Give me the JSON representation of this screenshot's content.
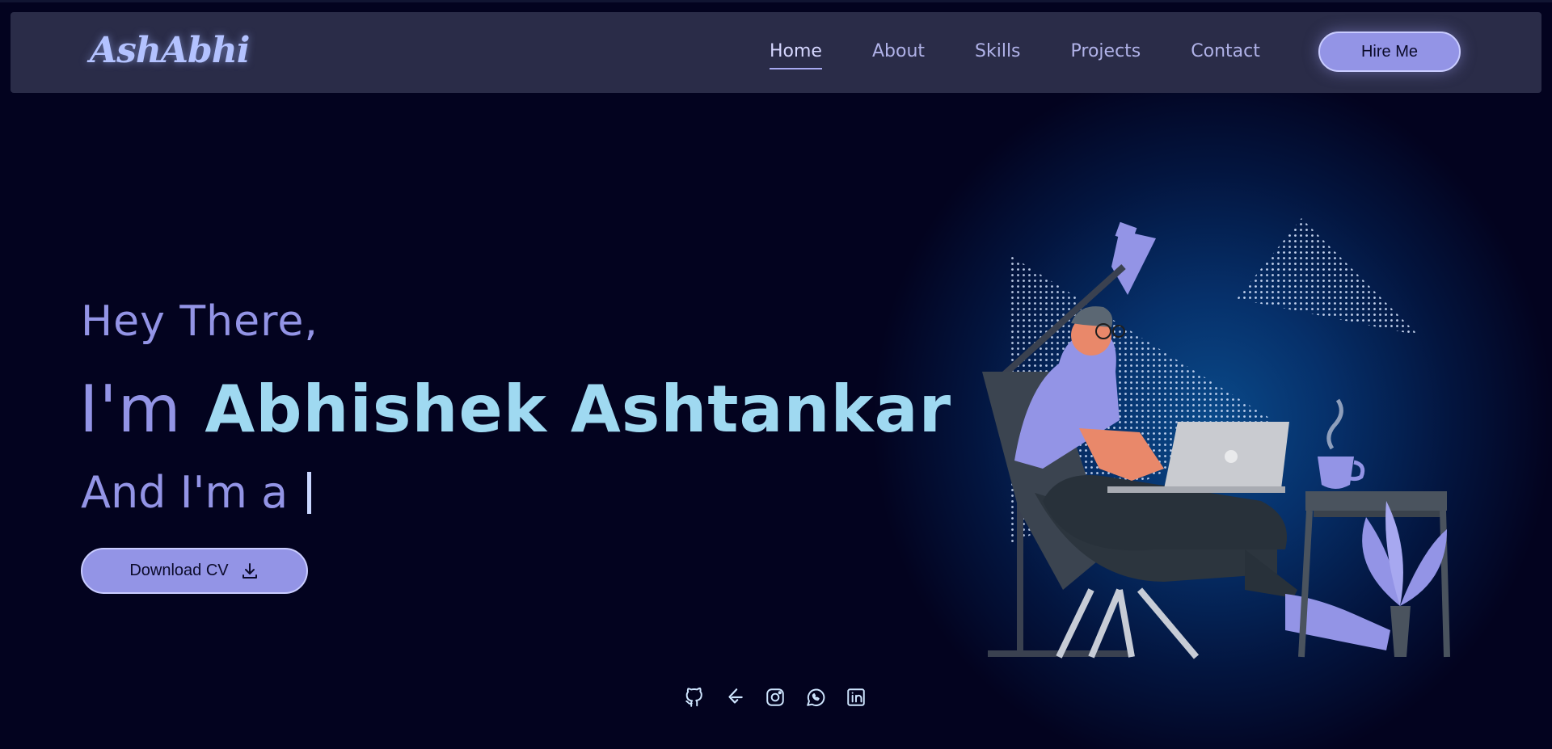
{
  "brand": {
    "logo_text": "AshAbhi"
  },
  "nav": {
    "items": [
      {
        "label": "Home",
        "active": true
      },
      {
        "label": "About",
        "active": false
      },
      {
        "label": "Skills",
        "active": false
      },
      {
        "label": "Projects",
        "active": false
      },
      {
        "label": "Contact",
        "active": false
      }
    ],
    "cta_label": "Hire Me"
  },
  "hero": {
    "greeting": "Hey There,",
    "name_prefix": "I'm",
    "name": "Abhishek Ashtankar",
    "role_prefix": "And I'm a",
    "download_label": "Download CV"
  },
  "socials": [
    {
      "icon": "github-icon"
    },
    {
      "icon": "leetcode-icon"
    },
    {
      "icon": "instagram-icon"
    },
    {
      "icon": "whatsapp-icon"
    },
    {
      "icon": "linkedin-icon"
    }
  ],
  "colors": {
    "background": "#03031f",
    "navbar": "#2a2c48",
    "accent": "#9394e6",
    "name_color": "#9fd9f1",
    "glow": "#0a4a8a"
  }
}
